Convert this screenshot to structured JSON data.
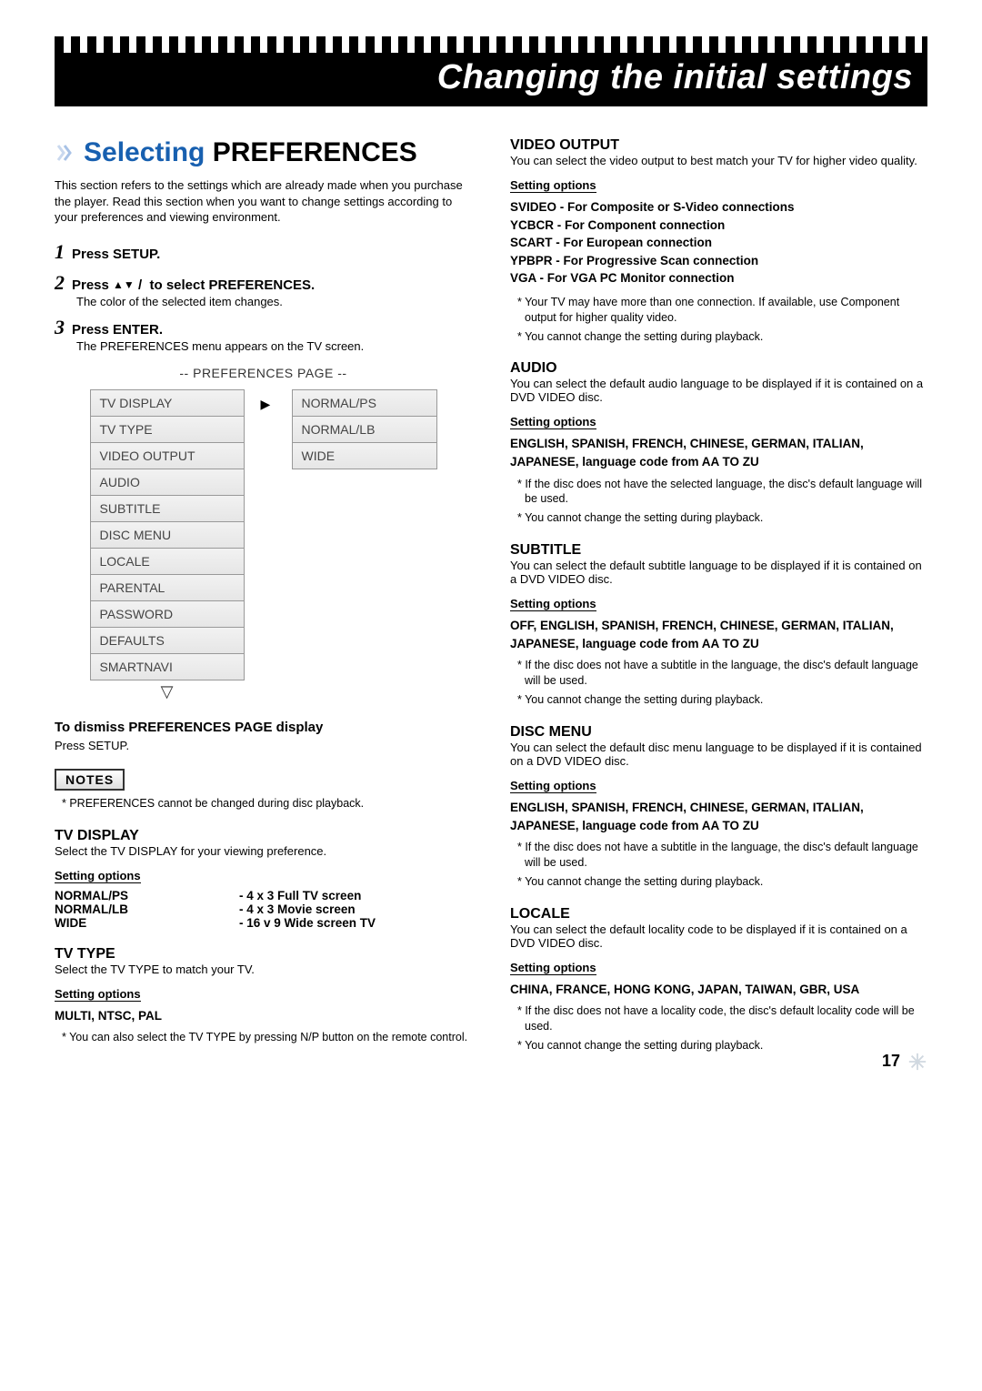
{
  "banner_title": "Changing the initial settings",
  "left": {
    "heading_plain": "Selecting ",
    "heading_bold": "PREFERENCES",
    "intro": "This section refers to the settings which are already made when you purchase the player. Read this section when you want to change settings according to your preferences and viewing environment.",
    "steps": {
      "s1": {
        "num": "1",
        "label": "Press SETUP."
      },
      "s2": {
        "num": "2",
        "label_pre": "Press ",
        "label_mid": " to select PREFERENCES.",
        "sub": "The color of the selected item changes."
      },
      "s3": {
        "num": "3",
        "label": "Press ENTER.",
        "sub": "The PREFERENCES menu appears on the TV screen."
      }
    },
    "pref_page_title": "-- PREFERENCES PAGE --",
    "menu": [
      "TV DISPLAY",
      "TV TYPE",
      "VIDEO OUTPUT",
      "AUDIO",
      "SUBTITLE",
      "DISC MENU",
      "LOCALE",
      "PARENTAL",
      "PASSWORD",
      "DEFAULTS",
      "SMARTNAVI"
    ],
    "opts": [
      "NORMAL/PS",
      "NORMAL/LB",
      "WIDE"
    ],
    "dismiss_h": "To dismiss PREFERENCES PAGE display",
    "dismiss_txt": "Press SETUP.",
    "notes_label": "NOTES",
    "notes_star": "* PREFERENCES cannot be changed during disc playback.",
    "tvdisp": {
      "h": "TV DISPLAY",
      "desc": "Select the TV DISPLAY  for your viewing preference.",
      "so": "Setting options",
      "rows": [
        {
          "k": "NORMAL/PS",
          "v": "- 4 x 3 Full TV screen"
        },
        {
          "k": "NORMAL/LB",
          "v": "- 4 x 3 Movie screen"
        },
        {
          "k": "WIDE",
          "v": "- 16 v 9 Wide screen TV"
        }
      ]
    },
    "tvtype": {
      "h": "TV TYPE",
      "desc": "Select the TV TYPE to match your TV.",
      "so": "Setting options",
      "val": "MULTI, NTSC, PAL",
      "star": "* You can also select the TV TYPE by pressing N/P button on the remote control."
    }
  },
  "right": {
    "video": {
      "h": "VIDEO OUTPUT",
      "desc": "You can select the video output to best match your TV for higher video quality.",
      "so": "Setting options",
      "lines": [
        "SVIDEO - For Composite or S-Video connections",
        "YCBCR  - For Component connection",
        "SCART  - For European connection",
        "YPBPR  - For Progressive Scan connection",
        "VGA       - For VGA PC Monitor connection"
      ],
      "stars": [
        "* Your TV may have more than one connection.  If available, use Component output for higher quality video.",
        "* You cannot change the setting during playback."
      ]
    },
    "audio": {
      "h": "AUDIO",
      "desc": "You can select the default audio language to be displayed if it is contained on a DVD VIDEO disc.",
      "so": "Setting options",
      "val": "ENGLISH, SPANISH, FRENCH, CHINESE, GERMAN, ITALIAN, JAPANESE, language code from AA TO ZU",
      "stars": [
        "* If the disc does not have the selected language, the disc's default language will be used.",
        "* You cannot change the setting during playback."
      ]
    },
    "subtitle": {
      "h": "SUBTITLE",
      "desc": "You can select the default subtitle language to be displayed if it is contained on a DVD VIDEO disc.",
      "so": "Setting options",
      "val": "OFF, ENGLISH, SPANISH, FRENCH, CHINESE, GERMAN, ITALIAN, JAPANESE, language code from AA TO ZU",
      "stars": [
        "* If the disc does not have a subtitle in the language, the disc's default language will be used.",
        "* You cannot change the setting during playback."
      ]
    },
    "discmenu": {
      "h": "DISC MENU",
      "desc": "You can select the default disc menu language to be displayed if it is contained on a DVD VIDEO disc.",
      "so": "Setting options",
      "val": "ENGLISH, SPANISH, FRENCH, CHINESE, GERMAN, ITALIAN, JAPANESE, language code from AA TO ZU",
      "stars": [
        "* If the disc does not have a subtitle in the language, the disc's default language will be used.",
        "* You cannot change the setting during playback."
      ]
    },
    "locale": {
      "h": "LOCALE",
      "desc": "You can select the default locality code to be displayed if it is contained on a DVD VIDEO disc.",
      "so": "Setting options",
      "val": "CHINA, FRANCE, HONG KONG, JAPAN, TAIWAN, GBR, USA",
      "stars": [
        "* If the disc does not have a locality code, the disc's default locality code will be used.",
        "* You cannot change the setting during playback."
      ]
    }
  },
  "page_number": "17"
}
